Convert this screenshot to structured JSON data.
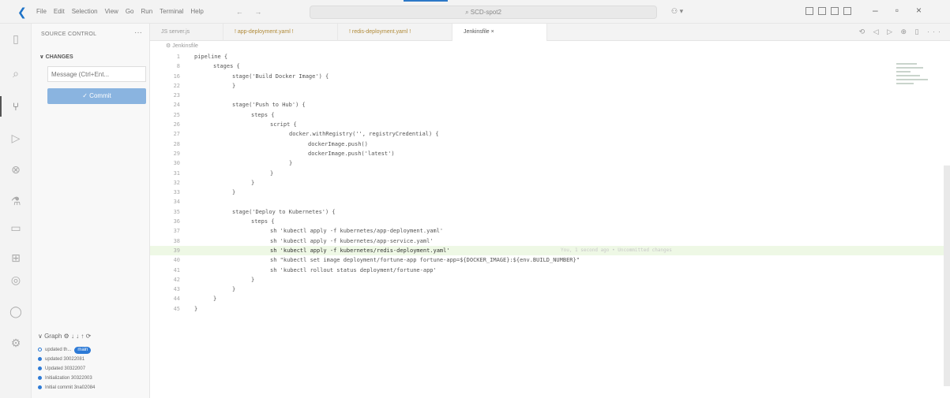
{
  "titlebar": {
    "menu": [
      "File",
      "Edit",
      "Selection",
      "View",
      "Go",
      "Run",
      "Terminal",
      "Help"
    ],
    "search": "SCD-spot2"
  },
  "sidebar": {
    "header": "SOURCE CONTROL",
    "changes_label": "CHANGES",
    "message_placeholder": "Message (Ctrl+Ent...",
    "commit_label": "✓ Commit",
    "graph_header": "Graph",
    "graph": [
      {
        "text": "updated th...",
        "badge": "main"
      },
      {
        "text": "updated 30022081"
      },
      {
        "text": "Updated 30322007"
      },
      {
        "text": "Initialization 30322003"
      },
      {
        "text": "Initial commit 3na02084"
      }
    ]
  },
  "tabs": [
    {
      "label": "JS server.js"
    },
    {
      "label": "! app-deployment.yaml !"
    },
    {
      "label": "! redis-deployment.yaml !"
    },
    {
      "label": "Jenkinsfile",
      "close": "×"
    }
  ],
  "editor": {
    "breadcrumb": "Jenkinsfile",
    "lines": [
      {
        "n": "1",
        "indent": 0,
        "code": "pipeline {"
      },
      {
        "n": "8",
        "indent": 1,
        "code": "stages {"
      },
      {
        "n": "16",
        "indent": 2,
        "code": "stage('Build Docker Image') {"
      },
      {
        "n": "22",
        "indent": 2,
        "code": "}"
      },
      {
        "n": "23",
        "indent": 0,
        "code": ""
      },
      {
        "n": "24",
        "indent": 2,
        "code": "stage('Push to Hub') {"
      },
      {
        "n": "25",
        "indent": 3,
        "code": "steps {"
      },
      {
        "n": "26",
        "indent": 4,
        "code": "script {"
      },
      {
        "n": "27",
        "indent": 5,
        "code": "docker.withRegistry('', registryCredential) {"
      },
      {
        "n": "28",
        "indent": 6,
        "code": "dockerImage.push()"
      },
      {
        "n": "29",
        "indent": 6,
        "code": "dockerImage.push('latest')"
      },
      {
        "n": "30",
        "indent": 5,
        "code": "}"
      },
      {
        "n": "31",
        "indent": 4,
        "code": "}"
      },
      {
        "n": "32",
        "indent": 3,
        "code": "}"
      },
      {
        "n": "33",
        "indent": 2,
        "code": "}"
      },
      {
        "n": "34",
        "indent": 0,
        "code": ""
      },
      {
        "n": "35",
        "indent": 2,
        "code": "stage('Deploy to Kubernetes') {"
      },
      {
        "n": "36",
        "indent": 3,
        "code": "steps {"
      },
      {
        "n": "37",
        "indent": 4,
        "code": "sh 'kubectl apply -f kubernetes/app-deployment.yaml'"
      },
      {
        "n": "38",
        "indent": 4,
        "code": "sh 'kubectl apply -f kubernetes/app-service.yaml'"
      },
      {
        "n": "39",
        "indent": 4,
        "code": "sh 'kubectl apply -f kubernetes/redis-deployment.yaml'",
        "highlight": true,
        "hint": "You, 1 second ago • Uncommitted changes"
      },
      {
        "n": "40",
        "indent": 4,
        "code": "sh \"kubectl set image deployment/fortune-app fortune-app=${DOCKER_IMAGE}:${env.BUILD_NUMBER}\""
      },
      {
        "n": "41",
        "indent": 4,
        "code": "sh 'kubectl rollout status deployment/fortune-app'"
      },
      {
        "n": "42",
        "indent": 3,
        "code": "}"
      },
      {
        "n": "43",
        "indent": 2,
        "code": "}"
      },
      {
        "n": "44",
        "indent": 1,
        "code": "}"
      },
      {
        "n": "45",
        "indent": 0,
        "code": "}"
      }
    ]
  }
}
